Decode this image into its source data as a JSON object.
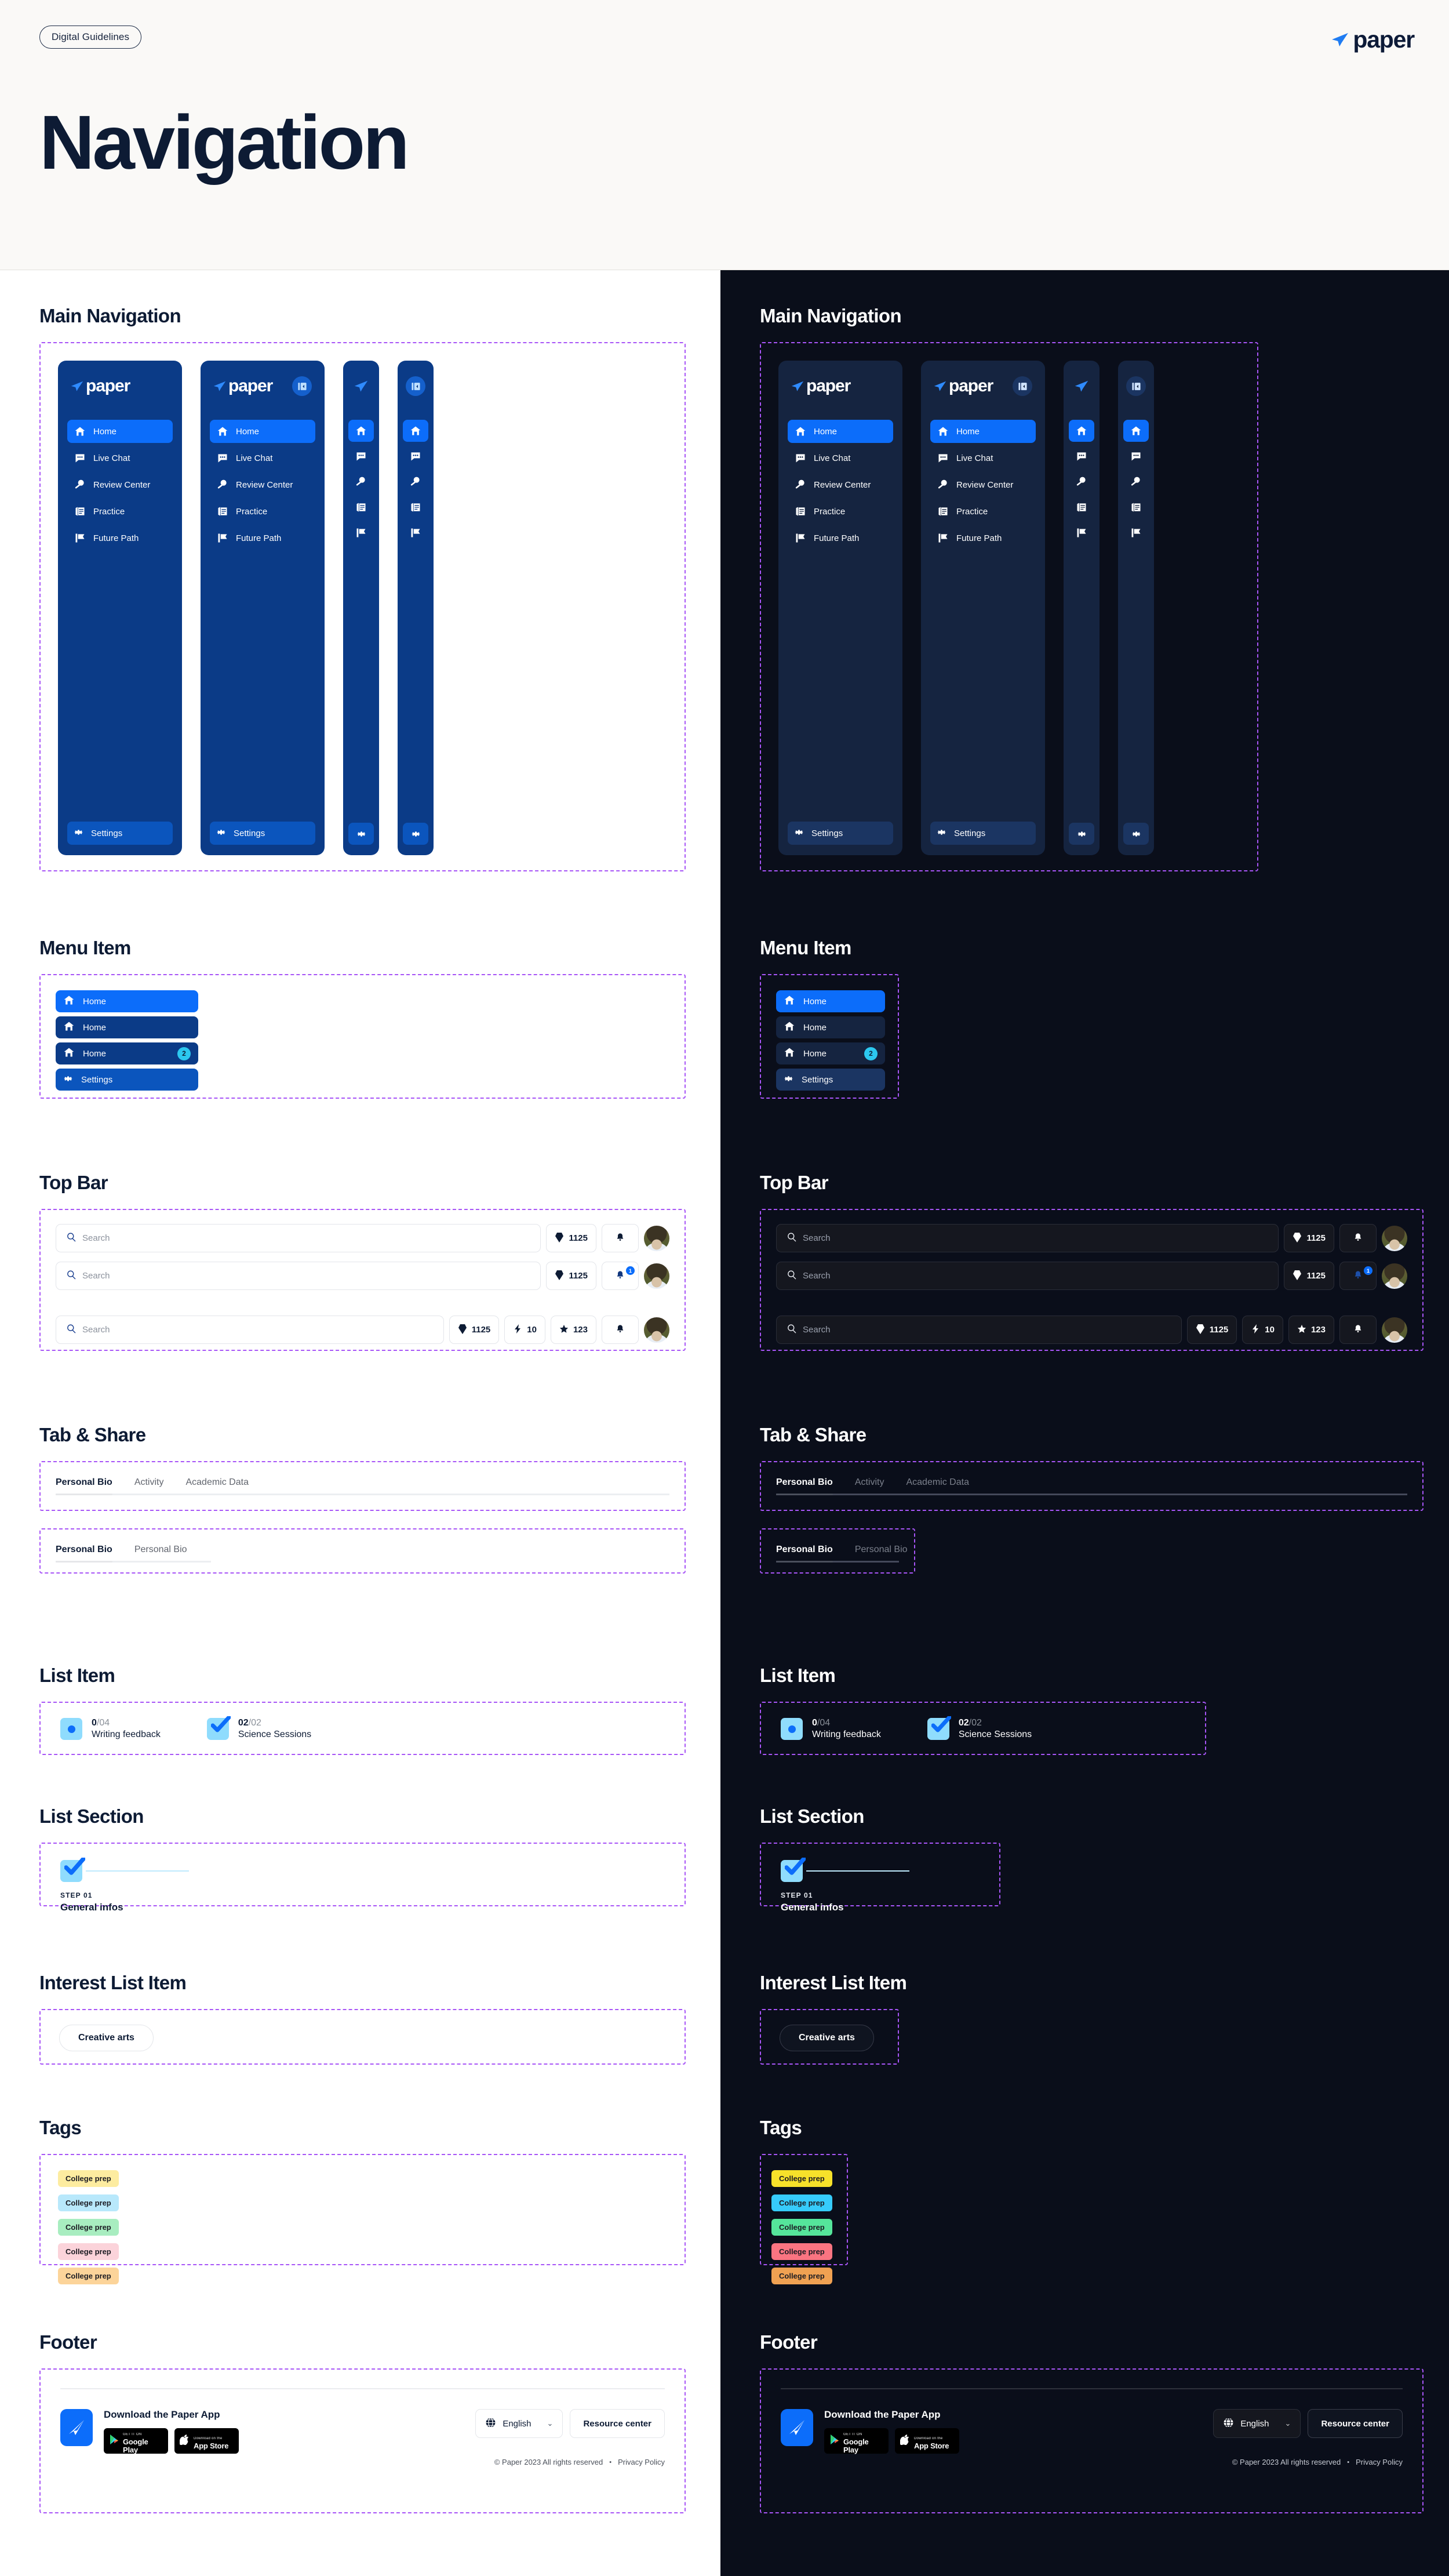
{
  "header": {
    "badge": "Digital Guidelines",
    "title": "Navigation",
    "brand": "paper",
    "brand_icon": "paper-plane-icon"
  },
  "sections": {
    "main_navigation": "Main Navigation",
    "menu_item": "Menu Item",
    "top_bar": "Top Bar",
    "tab_share": "Tab & Share",
    "list_item": "List Item",
    "list_section": "List Section",
    "interest_list_item": "Interest List Item",
    "tags": "Tags",
    "footer": "Footer"
  },
  "sidebar": {
    "brand": "paper",
    "collapse_icon": "panel-collapse-icon",
    "items": [
      {
        "label": "Home",
        "icon": "home-icon",
        "active": true
      },
      {
        "label": "Live Chat",
        "icon": "chat-bubble-icon",
        "active": false
      },
      {
        "label": "Review Center",
        "icon": "magnifier-icon",
        "active": false
      },
      {
        "label": "Practice",
        "icon": "document-stack-icon",
        "active": false
      },
      {
        "label": "Future Path",
        "icon": "flag-icon",
        "active": false
      }
    ],
    "settings": {
      "label": "Settings",
      "icon": "gear-icon"
    }
  },
  "menu_items": [
    {
      "label": "Home",
      "icon": "home-icon",
      "variant": "blue",
      "badge": ""
    },
    {
      "label": "Home",
      "icon": "home-icon",
      "variant": "navy",
      "badge": ""
    },
    {
      "label": "Home",
      "icon": "home-icon",
      "variant": "navy",
      "badge": "2"
    },
    {
      "label": "Settings",
      "icon": "gear-icon",
      "variant": "settings",
      "badge": ""
    }
  ],
  "top_bar": {
    "search_placeholder": "Search",
    "search_icon": "search-icon",
    "gem": {
      "icon": "gem-icon",
      "value": "1125"
    },
    "bolt": {
      "icon": "lightning-bolt-icon",
      "value": "10"
    },
    "star": {
      "icon": "star-icon",
      "value": "123"
    },
    "bell": {
      "icon": "bell-icon",
      "badge": "1"
    },
    "avatar": "user-avatar"
  },
  "tabs": {
    "full": [
      {
        "label": "Personal Bio",
        "active": true
      },
      {
        "label": "Activity",
        "active": false
      },
      {
        "label": "Academic Data",
        "active": false
      }
    ],
    "pair": [
      {
        "label": "Personal Bio",
        "active": true
      },
      {
        "label": "Personal Bio",
        "active": false
      }
    ]
  },
  "list_items": [
    {
      "current": "0",
      "separator": "/",
      "total": "04",
      "label": "Writing feedback",
      "marker": "dot-marker-icon"
    },
    {
      "current": "02",
      "separator": "/",
      "total": "02",
      "label": "Science Sessions",
      "marker": "check-marker-icon"
    }
  ],
  "list_section": {
    "step": "STEP 01",
    "name": "General infos",
    "marker": "check-marker-icon"
  },
  "interest_list_item": {
    "label": "Creative arts"
  },
  "tags": {
    "light": [
      {
        "label": "College prep",
        "color": "#fdeca0"
      },
      {
        "label": "College prep",
        "color": "#b8e8fb"
      },
      {
        "label": "College prep",
        "color": "#a8edc0"
      },
      {
        "label": "College prep",
        "color": "#fbd3da"
      },
      {
        "label": "College prep",
        "color": "#fcd49a"
      }
    ],
    "dark": [
      {
        "label": "College prep",
        "color": "#f7e12a"
      },
      {
        "label": "College prep",
        "color": "#36cbfb"
      },
      {
        "label": "College prep",
        "color": "#55e59b"
      },
      {
        "label": "College prep",
        "color": "#fa7481"
      },
      {
        "label": "College prep",
        "color": "#f5a council"
      }
    ]
  },
  "tags_dark": [
    {
      "label": "College prep",
      "color": "#f7e12a"
    },
    {
      "label": "College prep",
      "color": "#36cbfb"
    },
    {
      "label": "College prep",
      "color": "#55e59b"
    },
    {
      "label": "College prep",
      "color": "#fa7481"
    },
    {
      "label": "College prep",
      "color": "#f0a152"
    }
  ],
  "footer": {
    "app_title": "Download the Paper App",
    "app_icon": "paper-plane-app-icon",
    "google_play": {
      "small": "GET IT ON",
      "big": "Google Play",
      "icon": "google-play-icon"
    },
    "app_store": {
      "small": "Download on the",
      "big": "App Store",
      "icon": "apple-icon"
    },
    "language": {
      "label": "English",
      "icon": "globe-icon",
      "chevron": "chevron-down-icon"
    },
    "resource_center": "Resource center",
    "copyright": "© Paper 2023 All rights reserved",
    "separator": "•",
    "privacy": "Privacy Policy"
  },
  "colors": {
    "accent_blue": "#0c6dfa",
    "sidebar_light": "#0b3b87",
    "sidebar_dark": "#152440",
    "page_dark": "#0a0e1a",
    "ink": "#0d1b34",
    "dash": "#a855f7"
  }
}
